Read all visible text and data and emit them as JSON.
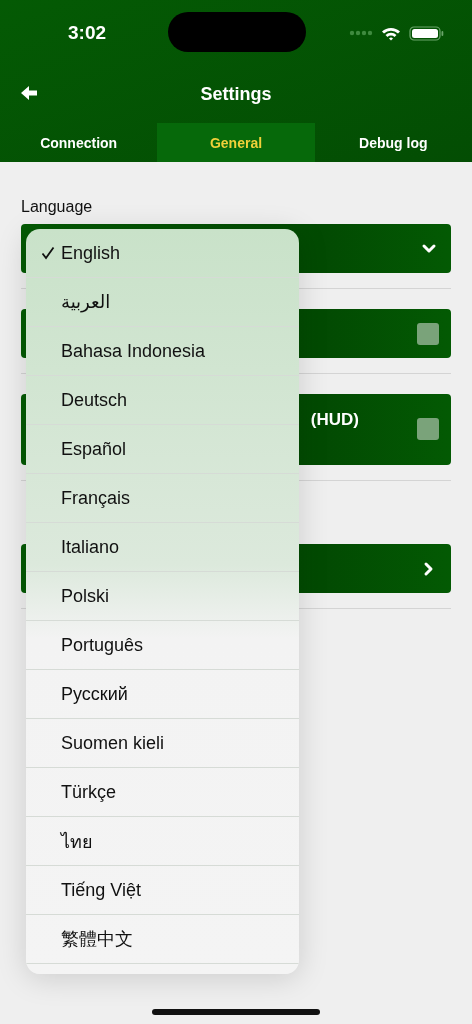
{
  "status_bar": {
    "time": "3:02"
  },
  "nav": {
    "title": "Settings"
  },
  "tabs": [
    {
      "label": "Connection",
      "selected": false
    },
    {
      "label": "General",
      "selected": true
    },
    {
      "label": "Debug log",
      "selected": false
    }
  ],
  "section_label": "Language",
  "rows": [
    {
      "kind": "dropdown"
    },
    {
      "kind": "checkbox",
      "checked": false
    },
    {
      "kind": "checkbox",
      "text": "(HUD)",
      "checked": false
    },
    {
      "kind": "link"
    }
  ],
  "menu": {
    "items": [
      {
        "label": "English",
        "selected": true
      },
      {
        "label": "العربية",
        "selected": false
      },
      {
        "label": "Bahasa Indonesia",
        "selected": false
      },
      {
        "label": "Deutsch",
        "selected": false
      },
      {
        "label": "Español",
        "selected": false
      },
      {
        "label": "Français",
        "selected": false
      },
      {
        "label": "Italiano",
        "selected": false
      },
      {
        "label": "Polski",
        "selected": false
      },
      {
        "label": "Português",
        "selected": false
      },
      {
        "label": "Русский",
        "selected": false
      },
      {
        "label": "Suomen kieli",
        "selected": false
      },
      {
        "label": "Türkçe",
        "selected": false
      },
      {
        "label": "ไทย",
        "selected": false
      },
      {
        "label": "Tiếng Việt",
        "selected": false
      },
      {
        "label": "繁體中文",
        "selected": false
      }
    ]
  }
}
